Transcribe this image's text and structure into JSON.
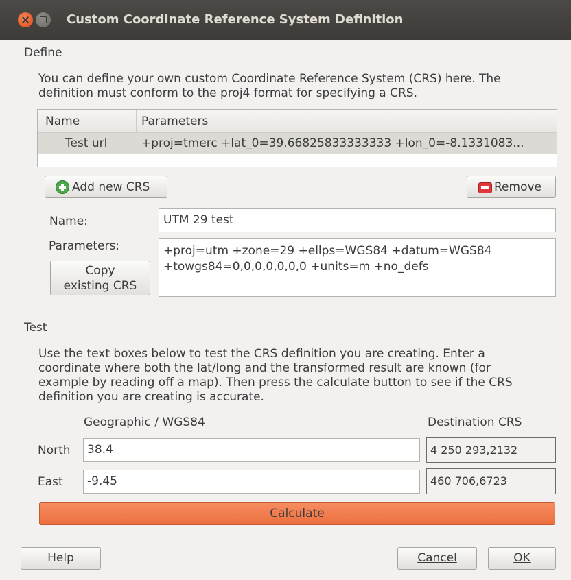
{
  "window": {
    "title": "Custom Coordinate Reference System Definition"
  },
  "define": {
    "section_label": "Define",
    "description_line1": "You can define your own custom Coordinate Reference System (CRS) here. The",
    "description_line2": "definition must conform to the proj4 format for specifying a CRS.",
    "table": {
      "columns": [
        "Name",
        "Parameters"
      ],
      "rows": [
        {
          "name": "Test url",
          "parameters": "+proj=tmerc +lat_0=39.66825833333333 +lon_0=-8.1331083..."
        }
      ]
    },
    "add_button": "Add new CRS",
    "remove_button": "Remove",
    "name_label": "Name:",
    "name_value": "UTM 29 test",
    "parameters_label": "Parameters:",
    "parameters_line1": "+proj=utm +zone=29 +ellps=WGS84 +datum=WGS84",
    "parameters_line2": "+towgs84=0,0,0,0,0,0,0 +units=m +no_defs",
    "copy_button_line1": "Copy",
    "copy_button_line2": "existing CRS"
  },
  "test": {
    "section_label": "Test",
    "description_line1": "Use the text boxes below to test the CRS definition you are creating. Enter a",
    "description_line2": "coordinate where both the lat/long and the transformed result are known (for",
    "description_line3": "example by reading off a map). Then press the calculate button to see if the CRS",
    "description_line4": "definition you are creating is accurate.",
    "geographic_header": "Geographic / WGS84",
    "destination_header": "Destination CRS",
    "north_label": "North",
    "north_value": "38.4",
    "north_result": "4 250 293,2132",
    "east_label": "East",
    "east_value": "-9.45",
    "east_result": "460 706,6723",
    "calculate_button": "Calculate"
  },
  "footer": {
    "help_button": "Help",
    "cancel_button": "Cancel",
    "ok_button": "OK"
  },
  "icons": {
    "close": "close-icon",
    "minimize": "minimize-icon",
    "add": "plus-icon",
    "remove": "minus-icon"
  },
  "colors": {
    "titlebar": "#3c3b37",
    "calculate_accent": "#ec6f3e",
    "selected_row": "#dcdad5",
    "window_bg": "#f2f1f0"
  }
}
